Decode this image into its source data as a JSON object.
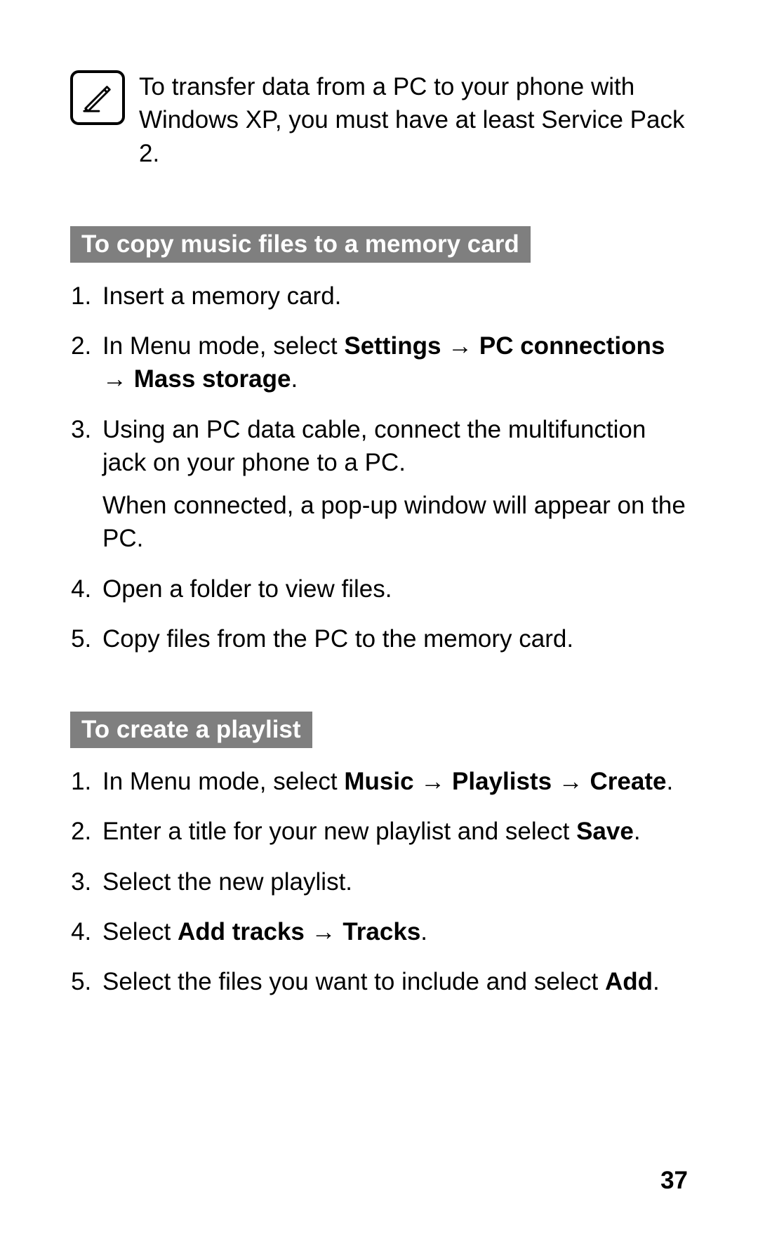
{
  "note_text": "To transfer data from a PC to your phone with Windows XP, you must have at least Service Pack 2.",
  "section_a": {
    "heading": "To copy music files to a memory card",
    "step1": "Insert a memory card.",
    "step2_prefix": "In Menu mode, select ",
    "step2_b1": "Settings",
    "step2_b2": "PC connections",
    "step2_b3": "Mass storage",
    "step2_period": ".",
    "step3_line1": "Using an PC data cable, connect the multifunction jack on your phone to a PC.",
    "step3_line2": "When connected, a pop-up window will appear on the PC.",
    "step4": "Open a folder to view files.",
    "step5": "Copy files from the PC to the memory card."
  },
  "section_b": {
    "heading": "To create a playlist",
    "step1_prefix": "In Menu mode, select ",
    "step1_b1": "Music",
    "step1_b2": "Playlists",
    "step1_b3": "Create",
    "step1_period": ".",
    "step2_prefix": "Enter a title for your new playlist and select ",
    "step2_b1": "Save",
    "step2_period": ".",
    "step3": "Select the new playlist.",
    "step4_prefix": "Select ",
    "step4_b1": "Add tracks",
    "step4_b2": "Tracks",
    "step4_period": ".",
    "step5_prefix": "Select the files you want to include and select ",
    "step5_b1": "Add",
    "step5_period": "."
  },
  "page_number": "37"
}
